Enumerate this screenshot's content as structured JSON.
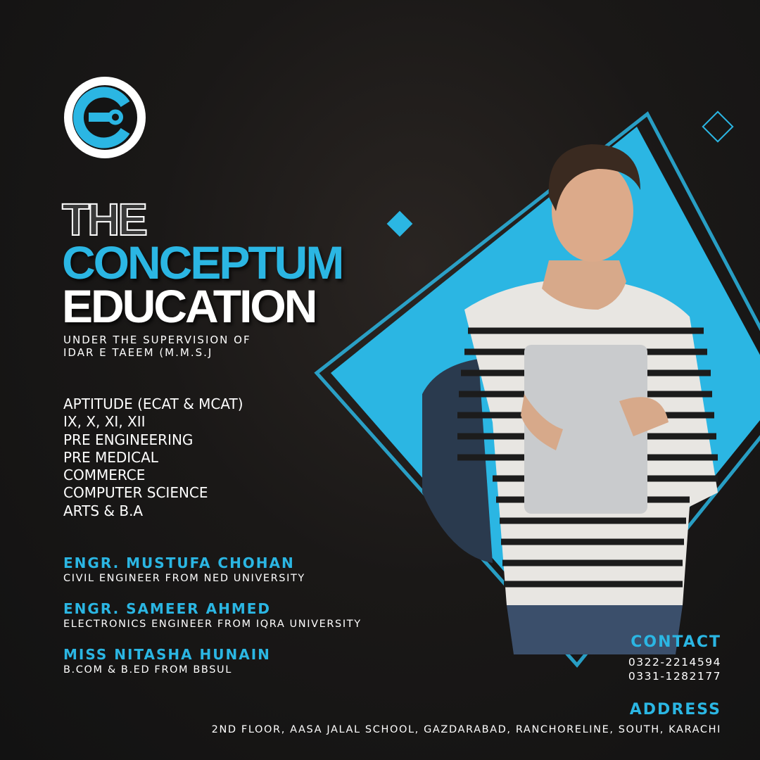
{
  "brand": {
    "line1": "THE",
    "line2": "CONCEPTUM",
    "line3": "EDUCATION",
    "logo": "conceptum-c-logo"
  },
  "supervision": [
    "UNDER THE SUPERVISION OF",
    "IDAR E TAEEM (M.M.S.J"
  ],
  "courses": [
    "APTITUDE (ECAT & MCAT)",
    "IX, X, XI, XII",
    "PRE ENGINEERING",
    "PRE MEDICAL",
    "COMMERCE",
    "COMPUTER SCIENCE",
    "ARTS & B.A"
  ],
  "teachers": [
    {
      "name": "ENGR. MUSTUFA CHOHAN",
      "desc": "CIVIL ENGINEER FROM NED UNIVERSITY"
    },
    {
      "name": "ENGR. SAMEER AHMED",
      "desc": "ELECTRONICS ENGINEER FROM IQRA UNIVERSITY"
    },
    {
      "name": "MISS NITASHA HUNAIN",
      "desc": "B.COM & B.ED FROM BBSUL"
    }
  ],
  "contact": {
    "heading": "CONTACT",
    "phones": [
      "0322-2214594",
      "0331-1282177"
    ]
  },
  "address": {
    "heading": "ADDRESS",
    "value": "2ND FLOOR, AASA JALAL SCHOOL, GAZDARABAD, RANCHORELINE, SOUTH, KARACHI"
  },
  "colors": {
    "accent": "#2bb6e3",
    "background": "#141414"
  }
}
